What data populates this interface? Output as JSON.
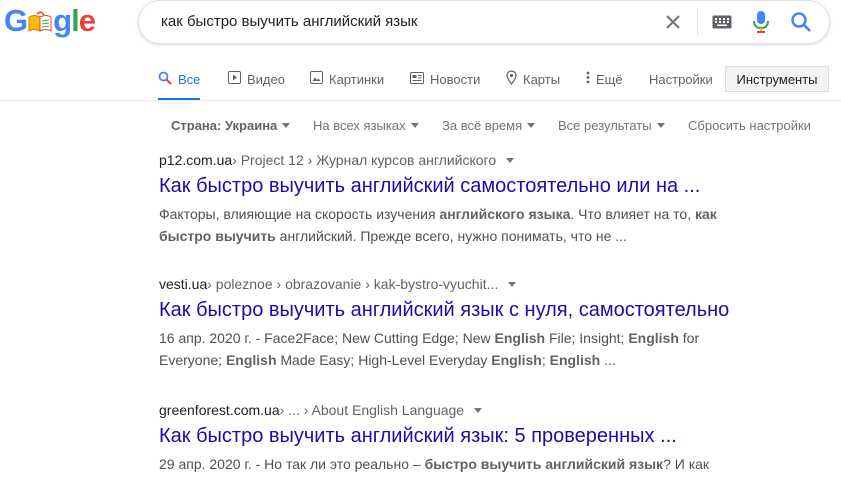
{
  "logo": {
    "text": "Google"
  },
  "search": {
    "query": "как быстро выучить английский язык"
  },
  "tabs": [
    {
      "label": "Все",
      "icon": "search-icon"
    },
    {
      "label": "Видео",
      "icon": "video-icon"
    },
    {
      "label": "Картинки",
      "icon": "image-icon"
    },
    {
      "label": "Новости",
      "icon": "news-icon"
    },
    {
      "label": "Карты",
      "icon": "map-pin-icon"
    },
    {
      "label": "Ещё",
      "icon": "more-vert-icon"
    }
  ],
  "settings_label": "Настройки",
  "tools_label": "Инструменты",
  "filters": {
    "country": "Страна: Украина",
    "language": "На всех языках",
    "time": "За всё время",
    "results": "Все результаты",
    "reset": "Сбросить настройки"
  },
  "results": [
    {
      "domain": "p12.com.ua",
      "path": " › Project 12 › Журнал курсов английского",
      "title": "Как быстро выучить английский самостоятельно или на ...",
      "snippet": [
        {
          "t": "Факторы, влияющие на скорость изучения ",
          "b": false
        },
        {
          "t": "английского языка",
          "b": true
        },
        {
          "t": ". Что влияет на то, ",
          "b": false
        },
        {
          "t": "как быстро выучить",
          "b": true
        },
        {
          "t": " английский. Прежде всего, нужно понимать, что не ...",
          "b": false
        }
      ]
    },
    {
      "domain": "vesti.ua",
      "path": " › poleznoe › obrazovanie › kak-bystro-vyuchit...",
      "title": "Как быстро выучить английский язык с нуля, самостоятельно",
      "snippet": [
        {
          "t": "16 апр. 2020 г. - Face2Face; New Cutting Edge; New ",
          "b": false
        },
        {
          "t": "English",
          "b": true
        },
        {
          "t": " File; Insight; ",
          "b": false
        },
        {
          "t": "English",
          "b": true
        },
        {
          "t": " for Everyone; ",
          "b": false
        },
        {
          "t": "English",
          "b": true
        },
        {
          "t": " Made Easy; High-Level Everyday ",
          "b": false
        },
        {
          "t": "English",
          "b": true
        },
        {
          "t": "; ",
          "b": false
        },
        {
          "t": "English",
          "b": true
        },
        {
          "t": " ...",
          "b": false
        }
      ]
    },
    {
      "domain": "greenforest.com.ua",
      "path": " › ... › About English Language",
      "title": "Как быстро выучить английский язык: 5 проверенных ...",
      "snippet": [
        {
          "t": "29 апр. 2020 г. - Но так ли это реально – ",
          "b": false
        },
        {
          "t": "быстро выучить английский язык",
          "b": true
        },
        {
          "t": "? И как",
          "b": false
        }
      ]
    }
  ],
  "colors": {
    "link": "#1a0dab",
    "accent": "#1a73e8"
  }
}
